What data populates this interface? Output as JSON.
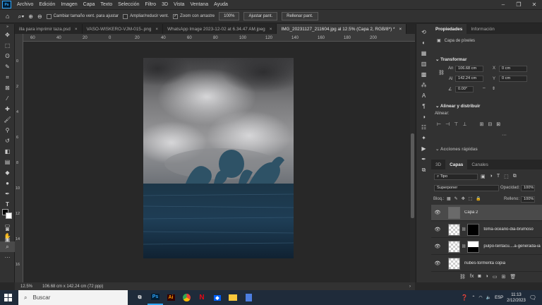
{
  "app": {
    "logo": "Ps",
    "menu": [
      "Archivo",
      "Edición",
      "Imagen",
      "Capa",
      "Texto",
      "Selección",
      "Filtro",
      "3D",
      "Vista",
      "Ventana",
      "Ayuda"
    ]
  },
  "options": {
    "resize_label": "Cambiar tamaño vent. para ajustar",
    "expand_label": "Ampliar/reducir vent.",
    "scrub_label": "Zoom con arrastre",
    "zoom_value": "100%",
    "fit_button": "Ajustar pant.",
    "fill_button": "Rellenar pant."
  },
  "tabs": [
    {
      "label": "illa para imprimir taza.psd"
    },
    {
      "label": "VASO-WISKERO-VJM-015-.png"
    },
    {
      "label": "WhatsApp Image 2023-12-02 at 6.34.47 AM.jpeg"
    },
    {
      "label": "IMG_20231127_211604.jpg al 12.5% (Capa 2, RGB/8*) *"
    }
  ],
  "rulers": {
    "h": [
      "60",
      "40",
      "20",
      "0",
      "20",
      "40",
      "60",
      "80",
      "100",
      "120",
      "140",
      "160",
      "180",
      "200"
    ],
    "v": [
      "0",
      "2",
      "4",
      "6",
      "8",
      "10",
      "12",
      "14",
      "16",
      "18"
    ]
  },
  "status": {
    "zoom": "12.5%",
    "size": "106.68 cm x 142.24 cm (72 ppp)"
  },
  "properties": {
    "tab_active": "Propiedades",
    "tab_other": "Información",
    "layer_kind": "Capa de píxeles",
    "transform_title": "Transformar",
    "w_label": "An",
    "w_value": "106.68 cm",
    "h_label": "Al",
    "h_value": "142.24 cm",
    "x_label": "X",
    "x_value": "0 cm",
    "y_label": "Y",
    "y_value": "0 cm",
    "angle": "0.00°",
    "align_title": "Alinear y distribuir",
    "align_label": "Alinear:",
    "more_title": "Acciones rápidas"
  },
  "layers_panel": {
    "tabs": [
      "3D",
      "Capas",
      "Canales"
    ],
    "filter": "Tipo",
    "blend_mode": "Superponer",
    "opacity_label": "Opacidad:",
    "opacity": "100%",
    "lock_label": "Bloq.:",
    "fill_label": "Relleno:",
    "fill": "100%",
    "layers": [
      {
        "name": "Capa 2"
      },
      {
        "name": "toma-oceano-dia-brumoso"
      },
      {
        "name": "pulpo-tentacu....a-generada-ia"
      },
      {
        "name": "nubes-tormenta copia"
      }
    ]
  },
  "taskbar": {
    "search_placeholder": "Buscar",
    "apps": [
      "Ps",
      "Ai",
      "Chrome",
      "N",
      "Dropbox",
      "Explorer",
      "Calc"
    ],
    "lang": "ESP",
    "time": "11:13",
    "date": "2/12/2023"
  },
  "colors": {
    "accent": "#31a8ff",
    "illustrator": "#ff9a00"
  }
}
